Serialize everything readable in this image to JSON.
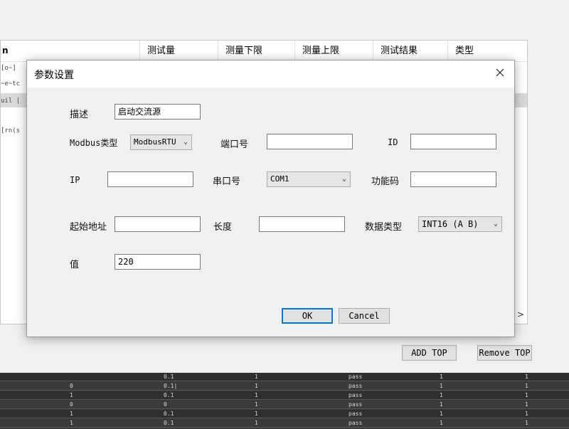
{
  "background": {
    "columns": [
      "测试量",
      "测量下限",
      "测量上限",
      "测试结果",
      "类型"
    ],
    "first_col_fragment": "n",
    "left_fragments": [
      "[o~]",
      "~e~tc",
      "uil |",
      "[rn(s"
    ],
    "add_button": "ADD TOP",
    "remove_button": "Remove TOP",
    "scroll_arrow": ">",
    "grid_rows": [
      [
        "",
        "0.1",
        "1",
        "pass",
        "1",
        "1"
      ],
      [
        "0",
        "0.1|",
        "1",
        "pass",
        "1",
        "1"
      ],
      [
        "1",
        "0.1",
        "1",
        "pass",
        "1",
        "1"
      ],
      [
        "0",
        "0",
        "1",
        "pass",
        "1",
        "1"
      ],
      [
        "1",
        "0.1",
        "1",
        "pass",
        "1",
        "1"
      ],
      [
        "1",
        "0.1",
        "1",
        "pass",
        "1",
        "1"
      ]
    ]
  },
  "dialog": {
    "title": "参数设置",
    "fields": {
      "description": {
        "label": "描述",
        "value": "启动交流源"
      },
      "modbus_type": {
        "label": "Modbus类型",
        "value": "ModbusRTU"
      },
      "port_number": {
        "label": "端口号",
        "value": ""
      },
      "id": {
        "label": "ID",
        "value": ""
      },
      "ip": {
        "label": "IP",
        "value": ""
      },
      "serial_port": {
        "label": "串口号",
        "value": "COM1"
      },
      "function_code": {
        "label": "功能码",
        "value": ""
      },
      "start_address": {
        "label": "起始地址",
        "value": ""
      },
      "length": {
        "label": "长度",
        "value": ""
      },
      "data_type": {
        "label": "数据类型",
        "value": "INT16 (A B)"
      },
      "value": {
        "label": "值",
        "value": "220"
      }
    },
    "ok_label": "OK",
    "cancel_label": "Cancel"
  }
}
